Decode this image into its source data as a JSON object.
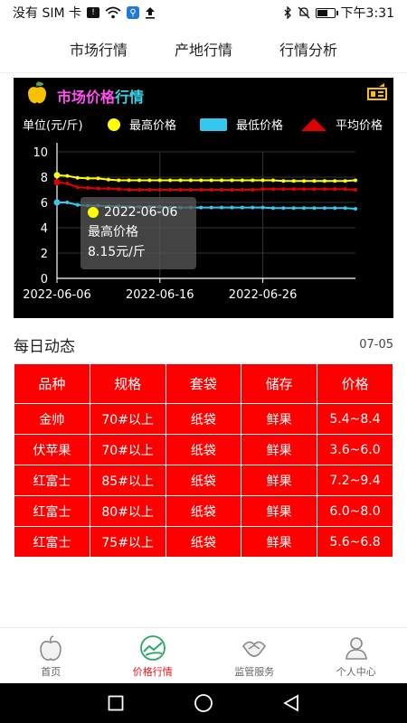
{
  "status_bar": {
    "carrier": "没有 SIM 卡",
    "time": "下午3:31",
    "battery_level": 0.7,
    "icons": [
      "sim-badge-icon",
      "wifi-icon",
      "search-badge-icon",
      "upload-icon",
      "bluetooth-icon",
      "mute-bell-icon",
      "battery-icon"
    ]
  },
  "tabs": [
    {
      "label": "市场行情",
      "active": true
    },
    {
      "label": "产地行情",
      "active": false
    },
    {
      "label": "行情分析",
      "active": false
    }
  ],
  "chart_panel": {
    "title_main": "市场价格",
    "title_highlight": "行情",
    "icons": [
      "apple-icon",
      "switch-icon"
    ],
    "colors": {
      "title": "#ff4ff0",
      "highlight": "#35d6e8",
      "max": "#ffff00",
      "min": "#35c8ef",
      "avg": "#e00000"
    }
  },
  "chart_data": {
    "type": "line",
    "ylabel": "单位(元/斤)",
    "ylim": [
      0,
      10
    ],
    "yticks": [
      "0",
      "2",
      "4",
      "6",
      "8",
      "10"
    ],
    "xticks": [
      "2022-06-06",
      "2022-06-16",
      "2022-06-26"
    ],
    "x": [
      "2022-06-06",
      "2022-06-07",
      "2022-06-08",
      "2022-06-09",
      "2022-06-10",
      "2022-06-11",
      "2022-06-12",
      "2022-06-13",
      "2022-06-14",
      "2022-06-15",
      "2022-06-16",
      "2022-06-17",
      "2022-06-18",
      "2022-06-19",
      "2022-06-20",
      "2022-06-21",
      "2022-06-22",
      "2022-06-23",
      "2022-06-24",
      "2022-06-25",
      "2022-06-26",
      "2022-06-27",
      "2022-06-28",
      "2022-06-29",
      "2022-06-30",
      "2022-07-01",
      "2022-07-02",
      "2022-07-03",
      "2022-07-04",
      "2022-07-05"
    ],
    "series": [
      {
        "name": "最高价格",
        "values": [
          8.15,
          8.1,
          7.95,
          7.9,
          7.9,
          7.8,
          7.75,
          7.75,
          7.75,
          7.75,
          7.75,
          7.75,
          7.75,
          7.75,
          7.75,
          7.75,
          7.75,
          7.75,
          7.75,
          7.75,
          7.75,
          7.75,
          7.7,
          7.7,
          7.7,
          7.7,
          7.7,
          7.7,
          7.7,
          7.75
        ]
      },
      {
        "name": "最低价格",
        "values": [
          6.0,
          6.0,
          5.8,
          5.75,
          5.75,
          5.7,
          5.7,
          5.65,
          5.65,
          5.65,
          5.65,
          5.6,
          5.6,
          5.6,
          5.6,
          5.6,
          5.6,
          5.6,
          5.6,
          5.6,
          5.6,
          5.55,
          5.55,
          5.55,
          5.55,
          5.55,
          5.55,
          5.55,
          5.55,
          5.5
        ]
      },
      {
        "name": "平均价格",
        "values": [
          7.6,
          7.5,
          7.2,
          7.15,
          7.1,
          7.1,
          7.05,
          7.0,
          7.0,
          7.0,
          7.0,
          7.0,
          7.0,
          7.0,
          7.0,
          7.0,
          7.0,
          7.0,
          7.0,
          7.0,
          7.05,
          7.05,
          7.05,
          7.05,
          7.05,
          7.05,
          7.05,
          7.05,
          7.05,
          7.0
        ]
      }
    ],
    "tooltip": {
      "date": "2022-06-06",
      "series_name": "最高价格",
      "value": "8.15元/斤"
    },
    "grid": true,
    "legend": "top"
  },
  "daily": {
    "title": "每日动态",
    "date": "07-05",
    "headers": [
      "品种",
      "规格",
      "套袋",
      "储存",
      "价格"
    ],
    "rows": [
      [
        "金帅",
        "70#以上",
        "纸袋",
        "鲜果",
        "5.4~8.4"
      ],
      [
        "伏苹果",
        "70#以上",
        "纸袋",
        "鲜果",
        "3.6~6.0"
      ],
      [
        "红富士",
        "85#以上",
        "纸袋",
        "鲜果",
        "7.2~9.4"
      ],
      [
        "红富士",
        "80#以上",
        "纸袋",
        "鲜果",
        "6.0~8.0"
      ],
      [
        "红富士",
        "75#以上",
        "纸袋",
        "鲜果",
        "5.6~6.8"
      ]
    ]
  },
  "bottom_nav": [
    {
      "label": "首页",
      "icon": "apple-outline-icon",
      "active": false
    },
    {
      "label": "价格行情",
      "icon": "price-chart-icon",
      "active": true
    },
    {
      "label": "监管服务",
      "icon": "handshake-icon",
      "active": false
    },
    {
      "label": "个人中心",
      "icon": "person-icon",
      "active": false
    }
  ],
  "system_nav": [
    "square-recent-icon",
    "circle-home-icon",
    "triangle-back-icon"
  ]
}
